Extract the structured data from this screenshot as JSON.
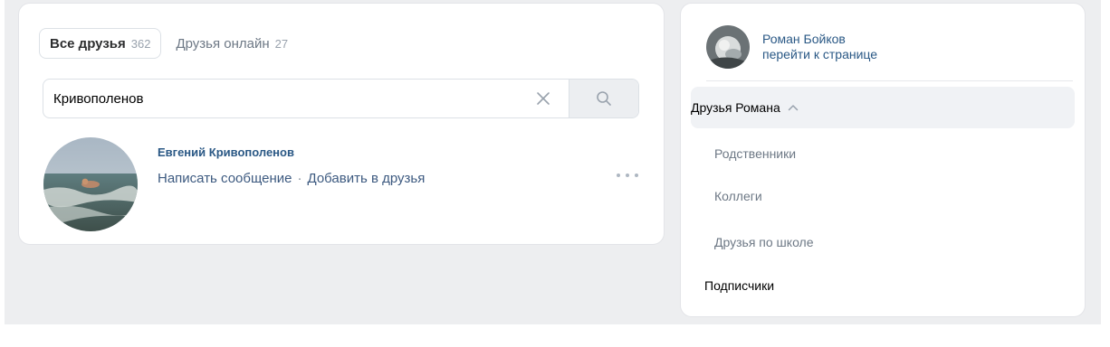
{
  "tabs": [
    {
      "label": "Все друзья",
      "count": "362"
    },
    {
      "label": "Друзья онлайн",
      "count": "27"
    }
  ],
  "search": {
    "value": "Кривополенов"
  },
  "friend": {
    "name": "Евгений Кривополенов",
    "actions": [
      "Написать сообщение",
      "Добавить в друзья"
    ],
    "separator": "·"
  },
  "sidebar": {
    "profile_name": "Роман Бойков",
    "profile_link": "перейти к странице",
    "group": "Друзья Романа",
    "items": [
      "Родственники",
      "Коллеги",
      "Друзья по школе"
    ],
    "followers": "Подписчики"
  },
  "colors": {
    "background": "#edeef0",
    "card": "#ffffff",
    "link": "#2a5885",
    "secondary": "#818c99"
  },
  "icons": [
    "clear-icon",
    "search-icon",
    "more-icon",
    "chevron-up-icon"
  ]
}
